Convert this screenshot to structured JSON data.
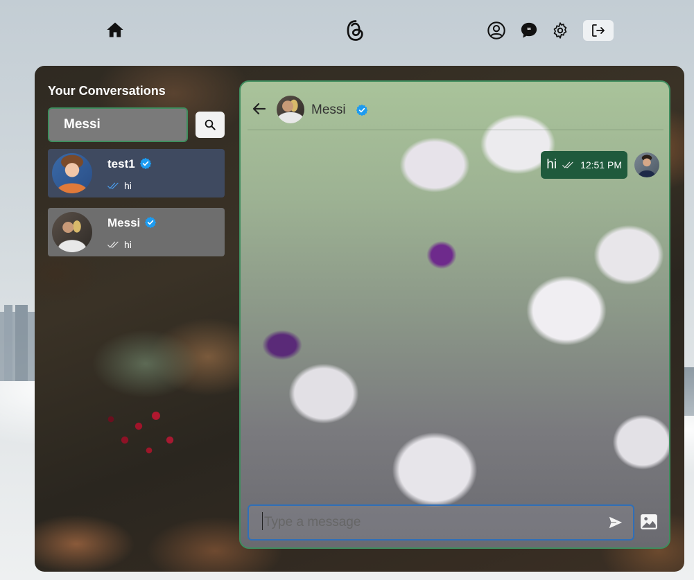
{
  "nav": {
    "icons": [
      "home-icon",
      "threads-logo-icon",
      "profile-icon",
      "chat-icon",
      "settings-icon",
      "logout-icon"
    ]
  },
  "sidebar": {
    "title": "Your Conversations",
    "search": {
      "value": "Messi",
      "icon": "search-icon"
    },
    "conversations": [
      {
        "name": "test1",
        "verified": true,
        "last_message": "hi",
        "read_status": "double-check",
        "active": true
      },
      {
        "name": "Messi",
        "verified": true,
        "last_message": "hi",
        "read_status": "double-check",
        "active": false
      }
    ]
  },
  "chat": {
    "contact_name": "Messi",
    "verified": true,
    "messages": [
      {
        "text": "hi",
        "time": "12:51 PM",
        "status": "double-check",
        "own": true
      }
    ],
    "input": {
      "placeholder": "Type a message",
      "value": ""
    }
  },
  "colors": {
    "accent_green": "#3f8d5e",
    "bubble_green": "#1f5a3c",
    "verified_blue": "#1d9bf0",
    "input_border_blue": "#2f6fb8"
  }
}
